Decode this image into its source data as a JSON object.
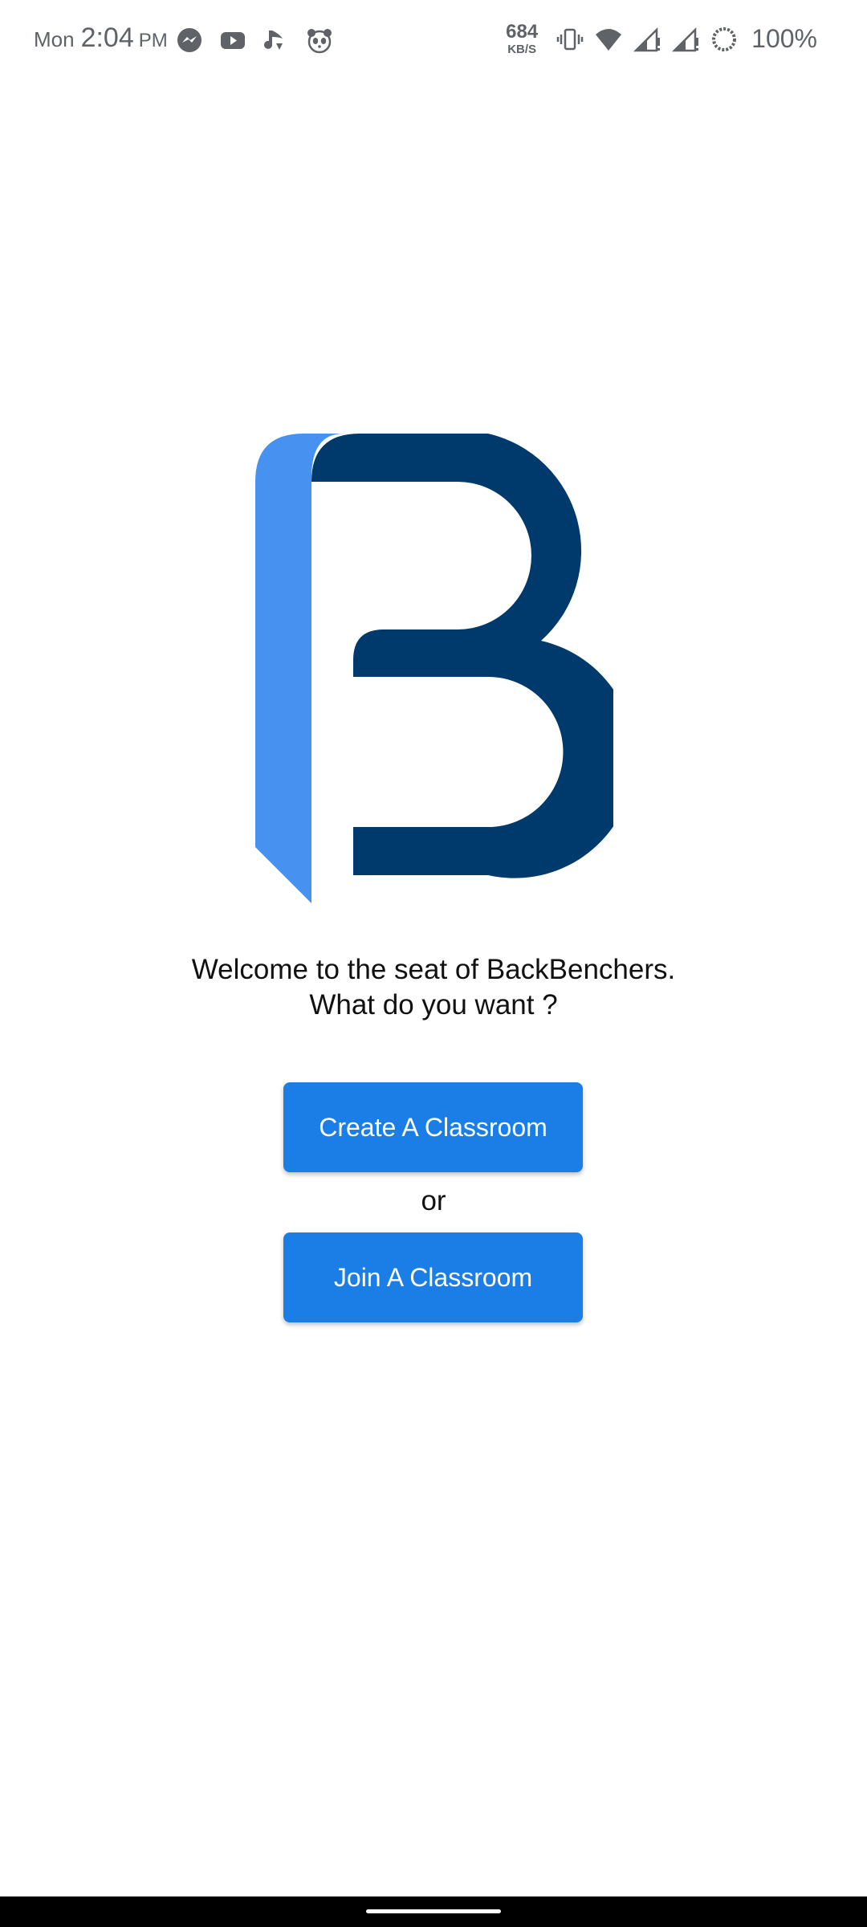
{
  "status_bar": {
    "day": "Mon",
    "time": "2:04",
    "ampm": "PM",
    "notification_icons": [
      "messenger-icon",
      "youtube-icon",
      "music-app-icon",
      "panda-app-icon"
    ],
    "network_speed_value": "684",
    "network_speed_unit": "KB/S",
    "system_icons": [
      "vibrate-icon",
      "wifi-icon",
      "signal-sim1-icon",
      "signal-sim2-icon",
      "battery-saver-icon"
    ],
    "battery_percent": "100%"
  },
  "logo": {
    "light_color": "#4791f1",
    "dark_color": "#003a6c"
  },
  "welcome": {
    "line1": "Welcome to the seat of BackBenchers.",
    "line2": "What do you want ?"
  },
  "actions": {
    "create_label": "Create A Classroom",
    "or_label": "or",
    "join_label": "Join A Classroom"
  },
  "colors": {
    "button": "#1a7ee6",
    "background": "#ffffff"
  }
}
